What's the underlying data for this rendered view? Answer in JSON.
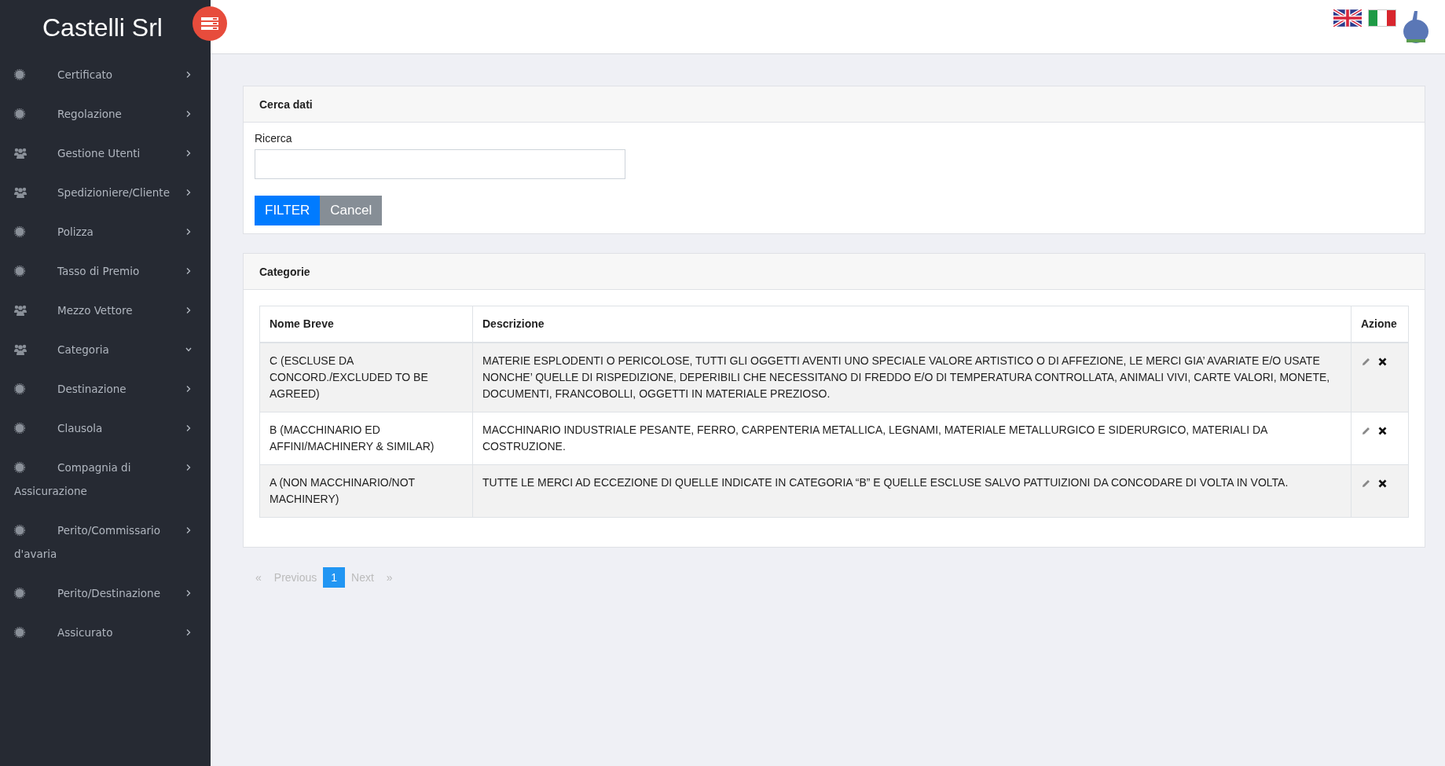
{
  "sidebar": {
    "brand": "Castelli Srl",
    "items": [
      {
        "label": "Certificato",
        "kind": "gear",
        "expanded": false
      },
      {
        "label": "Regolazione",
        "kind": "gear",
        "expanded": false
      },
      {
        "label": "Gestione Utenti",
        "kind": "users",
        "expanded": false
      },
      {
        "label": "Spedizioniere/Cliente",
        "kind": "users",
        "expanded": false
      },
      {
        "label": "Polizza",
        "kind": "gear",
        "expanded": false
      },
      {
        "label": "Tasso di Premio",
        "kind": "gear",
        "expanded": false
      },
      {
        "label": "Mezzo Vettore",
        "kind": "users",
        "expanded": false
      },
      {
        "label": "Categoria",
        "kind": "users",
        "expanded": true
      },
      {
        "label": "Destinazione",
        "kind": "gear",
        "expanded": false
      },
      {
        "label": "Clausola",
        "kind": "gear",
        "expanded": false
      },
      {
        "label": "Compagnia di Assicurazione",
        "kind": "gear",
        "expanded": false
      },
      {
        "label": "Perito/Commissario d'avaria",
        "kind": "gear",
        "expanded": false
      },
      {
        "label": "Perito/Destinazione",
        "kind": "gear",
        "expanded": false
      },
      {
        "label": "Assicurato",
        "kind": "gear",
        "expanded": false
      }
    ]
  },
  "search_card": {
    "title": "Cerca dati",
    "field_label": "Ricerca",
    "buttons": [
      {
        "label": "FILTER",
        "kind": "primary"
      },
      {
        "label": "Cancel",
        "kind": "secondary"
      }
    ]
  },
  "table_card": {
    "title": "Categorie",
    "columns": [
      "Nome Breve",
      "Descrizione",
      "Azione"
    ],
    "rows": [
      {
        "name": "C (ESCLUSE DA CONCORD./EXCLUDED TO BE AGREED)",
        "description": "MATERIE ESPLODENTI O PERICOLOSE, TUTTI GLI OGGETTI AVENTI UNO SPECIALE VALORE ARTISTICO O DI AFFEZIONE, LE MERCI GIA’ AVARIATE E/O USATE NONCHE’ QUELLE DI RISPEDIZIONE, DEPERIBILI CHE NECESSITANO DI FREDDO E/O DI TEMPERATURA CONTROLLATA, ANIMALI VIVI, CARTE VALORI, MONETE, DOCUMENTI, FRANCOBOLLI, OGGETTI IN MATERIALE PREZIOSO."
      },
      {
        "name": "B (MACCHINARIO ED AFFINI/MACHINERY & SIMILAR)",
        "description": "MACCHINARIO INDUSTRIALE PESANTE, FERRO, CARPENTERIA METALLICA, LEGNAMI, MATERIALE METALLURGICO E SIDERURGICO, MATERIALI DA COSTRUZIONE."
      },
      {
        "name": "A (NON MACCHINARIO/NOT MACHINERY)",
        "description": "TUTTE LE MERCI AD ECCEZIONE DI QUELLE INDICATE IN CATEGORIA “B” E QUELLE ESCLUSE SALVO PATTUIZIONI DA CONCODARE DI VOLTA IN VOLTA."
      }
    ]
  },
  "pagination": {
    "prev_arrow": "«",
    "prev": "Previous",
    "prev_disabled": true,
    "pages": [
      {
        "label": "1",
        "selected": true
      }
    ],
    "next": "Next",
    "next_arrow": "»",
    "next_disabled": true
  }
}
